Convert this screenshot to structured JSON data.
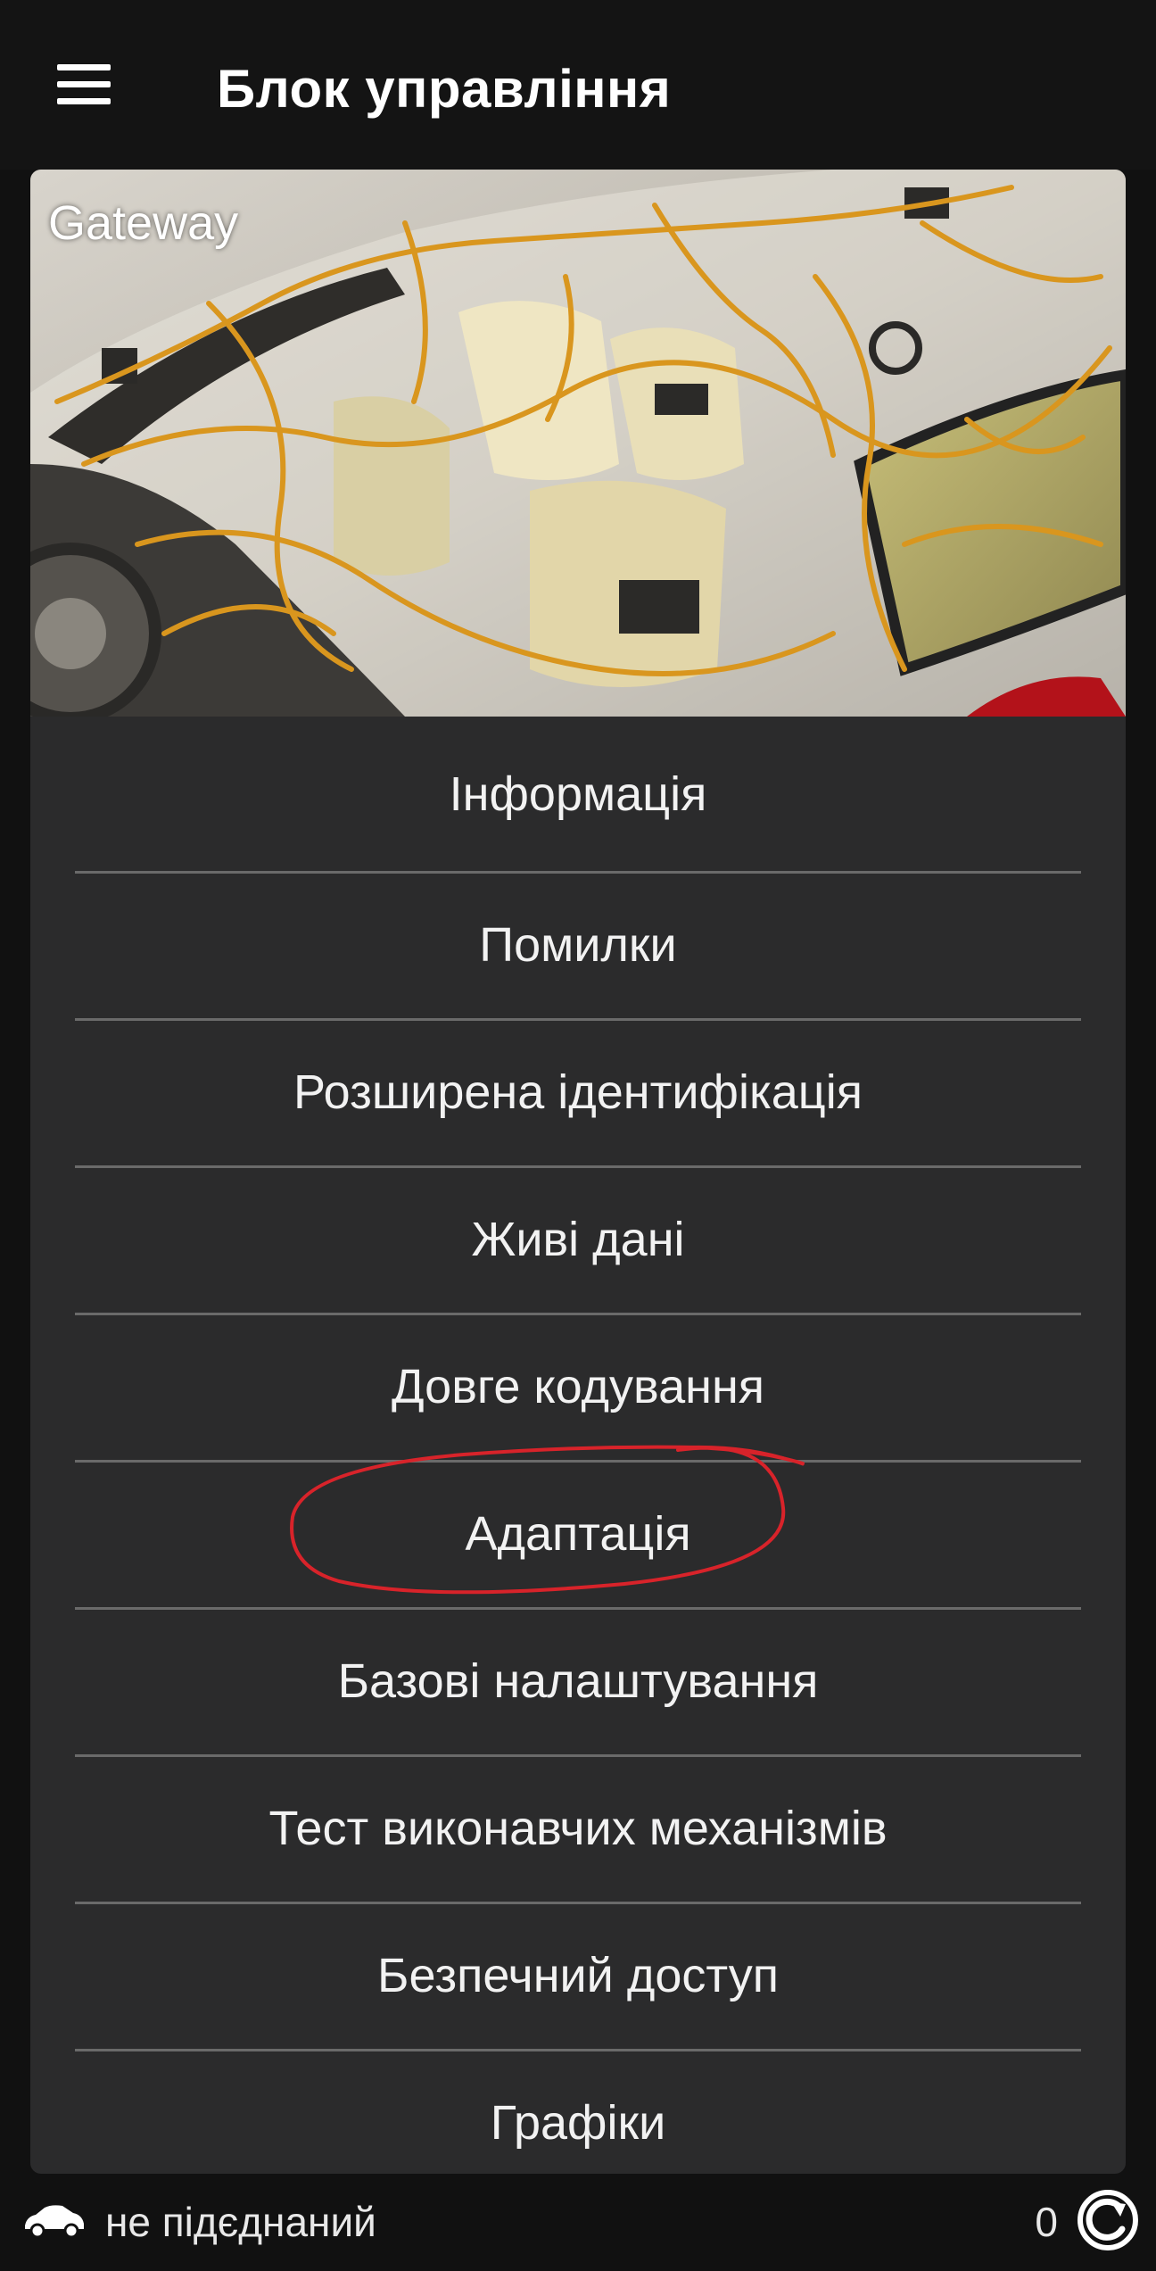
{
  "header": {
    "title": "Блок управління",
    "menu_icon": "hamburger-menu-icon"
  },
  "module": {
    "name": "Gateway",
    "image": "car-wiring-harness-photo"
  },
  "menu": {
    "items": [
      {
        "label": "Інформація"
      },
      {
        "label": "Помилки"
      },
      {
        "label": "Розширена ідентифікація"
      },
      {
        "label": "Живі дані"
      },
      {
        "label": "Довге кодування"
      },
      {
        "label": "Адаптація"
      },
      {
        "label": "Базові налаштування"
      },
      {
        "label": "Тест виконавчих механізмів"
      },
      {
        "label": "Безпечний доступ"
      },
      {
        "label": "Графіки"
      }
    ],
    "highlighted": "Адаптація",
    "highlight_color": "#d8232a"
  },
  "status": {
    "connection_icon": "car-connection-icon",
    "connection_text": "не підєднаний",
    "counter": "0",
    "sync_icon": "sync-icon"
  },
  "colors": {
    "background": "#111111",
    "card": "#2b2b2c",
    "divider": "#6a6a6a",
    "text": "#ffffff"
  }
}
